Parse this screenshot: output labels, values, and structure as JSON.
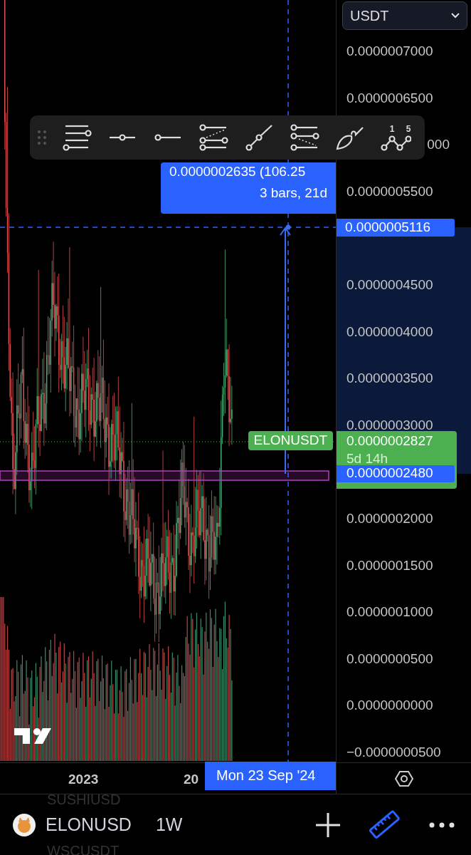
{
  "currency_selector": {
    "value": "USDT"
  },
  "price_axis": {
    "labels": [
      "0.0000007000",
      "0.0000006500",
      "000",
      "0.0000005500",
      "0.0000004500",
      "0.0000004000",
      "0.0000003500",
      "0.0000003000",
      "0.0000002000",
      "0.0000001500",
      "0.0000001000",
      "0.0000000500",
      "0.0000000000",
      "−0.0000000500"
    ]
  },
  "drawing_toolbar": {
    "tools": [
      {
        "kind": "fib"
      },
      {
        "kind": "hline"
      },
      {
        "kind": "ray"
      },
      {
        "kind": "pitchfork"
      },
      {
        "kind": "trendline"
      },
      {
        "kind": "fib_extension"
      },
      {
        "kind": "brush"
      },
      {
        "kind": "wave",
        "point_labels": [
          "1",
          "5"
        ]
      }
    ]
  },
  "measure": {
    "change": "0.0000002635 (106.25",
    "span": "3 bars, 21d"
  },
  "crosshair": {
    "price": "0.0000005116",
    "time": "Mon 23 Sep '24"
  },
  "symbol_tag": {
    "label": "ELONUSDT",
    "price": "0.0000002827",
    "countdown": "5d 14h"
  },
  "start_price": "0.0000002480",
  "time_axis": {
    "labels": [
      "2023",
      "20"
    ]
  },
  "bottom_bar": {
    "picker_above": "SUSHIUSD",
    "symbol": "ELONUSD",
    "interval": "1W",
    "picker_below": "WSCUSDT",
    "actions": [
      {
        "kind": "add",
        "selected": false
      },
      {
        "kind": "measure",
        "selected": true
      },
      {
        "kind": "more",
        "selected": false
      }
    ]
  }
}
